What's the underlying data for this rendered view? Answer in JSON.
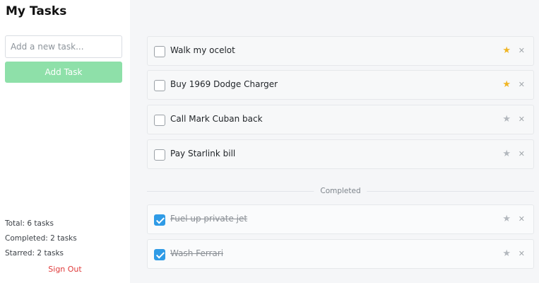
{
  "sidebar": {
    "title": "My Tasks",
    "input_placeholder": "Add a new task...",
    "add_button_label": "Add Task",
    "stats": {
      "total": "Total: 6 tasks",
      "completed": "Completed: 2 tasks",
      "starred": "Starred: 2 tasks"
    },
    "sign_out_label": "Sign Out"
  },
  "tasks": {
    "active": [
      {
        "text": "Walk my ocelot",
        "starred": true,
        "done": false
      },
      {
        "text": "Buy 1969 Dodge Charger",
        "starred": true,
        "done": false
      },
      {
        "text": "Call Mark Cuban back",
        "starred": false,
        "done": false
      },
      {
        "text": "Pay Starlink bill",
        "starred": false,
        "done": false
      }
    ],
    "completed_label": "Completed",
    "completed": [
      {
        "text": "Fuel up private jet",
        "starred": false,
        "done": true
      },
      {
        "text": "Wash Ferrari",
        "starred": false,
        "done": true
      }
    ]
  },
  "icons": {
    "star": "star-icon",
    "delete": "close-icon",
    "checkbox": "checkbox"
  },
  "colors": {
    "add_button": "#8ee0a9",
    "star_active": "#f0b524",
    "star_inactive": "#b3b8be",
    "checkbox_checked": "#2f9be6",
    "sign_out": "#e03b3b"
  }
}
